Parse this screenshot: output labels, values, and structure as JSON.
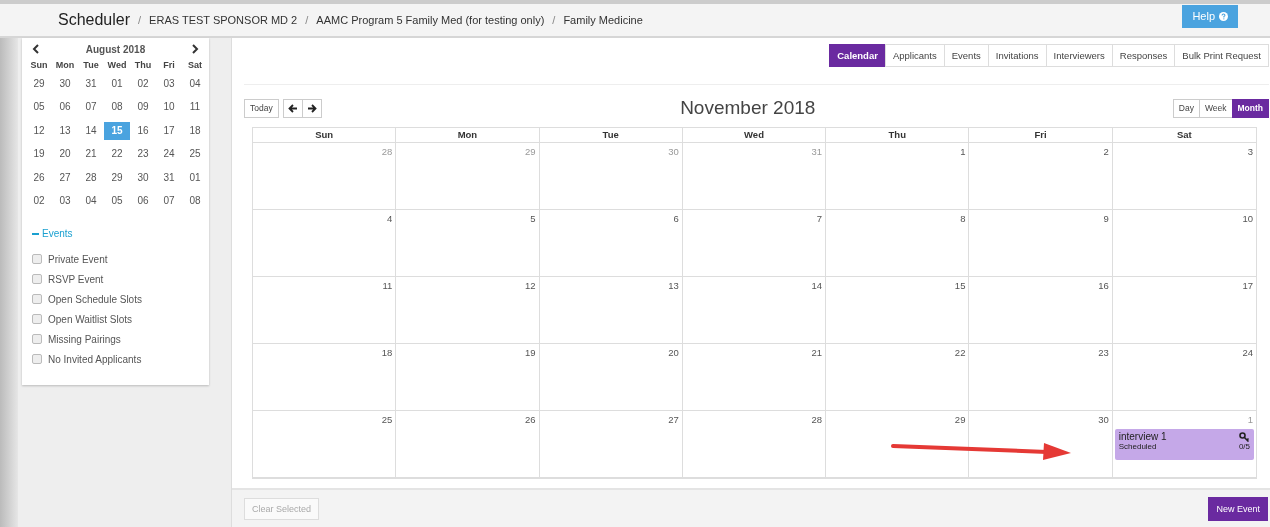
{
  "header": {
    "title": "Scheduler",
    "breadcrumbs": [
      "ERAS TEST SPONSOR MD 2",
      "AAMC Program 5 Family Med (for testing only)",
      "Family Medicine"
    ],
    "separator": "/",
    "help": "Help"
  },
  "mini_calendar": {
    "title": "August 2018",
    "weekdays": [
      "Sun",
      "Mon",
      "Tue",
      "Wed",
      "Thu",
      "Fri",
      "Sat"
    ],
    "weeks": [
      [
        {
          "day": "29",
          "selected": false
        },
        {
          "day": "30",
          "selected": false
        },
        {
          "day": "31",
          "selected": false
        },
        {
          "day": "01",
          "selected": false
        },
        {
          "day": "02",
          "selected": false
        },
        {
          "day": "03",
          "selected": false
        },
        {
          "day": "04",
          "selected": false
        }
      ],
      [
        {
          "day": "05",
          "selected": false
        },
        {
          "day": "06",
          "selected": false
        },
        {
          "day": "07",
          "selected": false
        },
        {
          "day": "08",
          "selected": false
        },
        {
          "day": "09",
          "selected": false
        },
        {
          "day": "10",
          "selected": false
        },
        {
          "day": "11",
          "selected": false
        }
      ],
      [
        {
          "day": "12",
          "selected": false
        },
        {
          "day": "13",
          "selected": false
        },
        {
          "day": "14",
          "selected": false
        },
        {
          "day": "15",
          "selected": true
        },
        {
          "day": "16",
          "selected": false
        },
        {
          "day": "17",
          "selected": false
        },
        {
          "day": "18",
          "selected": false
        }
      ],
      [
        {
          "day": "19",
          "selected": false
        },
        {
          "day": "20",
          "selected": false
        },
        {
          "day": "21",
          "selected": false
        },
        {
          "day": "22",
          "selected": false
        },
        {
          "day": "23",
          "selected": false
        },
        {
          "day": "24",
          "selected": false
        },
        {
          "day": "25",
          "selected": false
        }
      ],
      [
        {
          "day": "26",
          "selected": false
        },
        {
          "day": "27",
          "selected": false
        },
        {
          "day": "28",
          "selected": false
        },
        {
          "day": "29",
          "selected": false
        },
        {
          "day": "30",
          "selected": false
        },
        {
          "day": "31",
          "selected": false
        },
        {
          "day": "01",
          "selected": false
        }
      ],
      [
        {
          "day": "02",
          "selected": false
        },
        {
          "day": "03",
          "selected": false
        },
        {
          "day": "04",
          "selected": false
        },
        {
          "day": "05",
          "selected": false
        },
        {
          "day": "06",
          "selected": false
        },
        {
          "day": "07",
          "selected": false
        },
        {
          "day": "08",
          "selected": false
        }
      ]
    ]
  },
  "filters": {
    "heading": "Events",
    "expanded": true,
    "items": [
      {
        "label": "Private Event",
        "checked": false
      },
      {
        "label": "RSVP Event",
        "checked": false
      },
      {
        "label": "Open Schedule Slots",
        "checked": false
      },
      {
        "label": "Open Waitlist Slots",
        "checked": false
      },
      {
        "label": "Missing Pairings",
        "checked": false
      },
      {
        "label": "No Invited Applicants",
        "checked": false
      }
    ]
  },
  "tabs": [
    {
      "label": "Calendar",
      "selected": true
    },
    {
      "label": "Applicants",
      "selected": false
    },
    {
      "label": "Events",
      "selected": false
    },
    {
      "label": "Invitations",
      "selected": false
    },
    {
      "label": "Interviewers",
      "selected": false
    },
    {
      "label": "Responses",
      "selected": false
    },
    {
      "label": "Bulk Print Request",
      "selected": false
    }
  ],
  "toolbar": {
    "today": "Today",
    "title": "November 2018",
    "views": [
      {
        "label": "Day",
        "selected": false
      },
      {
        "label": "Week",
        "selected": false
      },
      {
        "label": "Month",
        "selected": true
      }
    ]
  },
  "calendar": {
    "weekdays": [
      "Sun",
      "Mon",
      "Tue",
      "Wed",
      "Thu",
      "Fri",
      "Sat"
    ],
    "weeks": [
      [
        {
          "day": "28",
          "muted": true
        },
        {
          "day": "29",
          "muted": true
        },
        {
          "day": "30",
          "muted": true
        },
        {
          "day": "31",
          "muted": true
        },
        {
          "day": "1",
          "muted": false
        },
        {
          "day": "2",
          "muted": false
        },
        {
          "day": "3",
          "muted": false
        }
      ],
      [
        {
          "day": "4",
          "muted": false
        },
        {
          "day": "5",
          "muted": false
        },
        {
          "day": "6",
          "muted": false
        },
        {
          "day": "7",
          "muted": false
        },
        {
          "day": "8",
          "muted": false
        },
        {
          "day": "9",
          "muted": false
        },
        {
          "day": "10",
          "muted": false
        }
      ],
      [
        {
          "day": "11",
          "muted": false
        },
        {
          "day": "12",
          "muted": false
        },
        {
          "day": "13",
          "muted": false
        },
        {
          "day": "14",
          "muted": false
        },
        {
          "day": "15",
          "muted": false
        },
        {
          "day": "16",
          "muted": false
        },
        {
          "day": "17",
          "muted": false
        }
      ],
      [
        {
          "day": "18",
          "muted": false
        },
        {
          "day": "19",
          "muted": false
        },
        {
          "day": "20",
          "muted": false
        },
        {
          "day": "21",
          "muted": false
        },
        {
          "day": "22",
          "muted": false
        },
        {
          "day": "23",
          "muted": false
        },
        {
          "day": "24",
          "muted": false
        }
      ],
      [
        {
          "day": "25",
          "muted": false
        },
        {
          "day": "26",
          "muted": false
        },
        {
          "day": "27",
          "muted": false
        },
        {
          "day": "28",
          "muted": false
        },
        {
          "day": "29",
          "muted": false
        },
        {
          "day": "30",
          "muted": false
        },
        {
          "day": "1",
          "muted": true,
          "events": [
            {
              "title": "interview 1",
              "status": "Scheduled",
              "count": "0/5"
            }
          ]
        }
      ]
    ]
  },
  "footer": {
    "clear": {
      "label": "Clear Selected",
      "disabled": true
    },
    "new_event": "New Event"
  }
}
